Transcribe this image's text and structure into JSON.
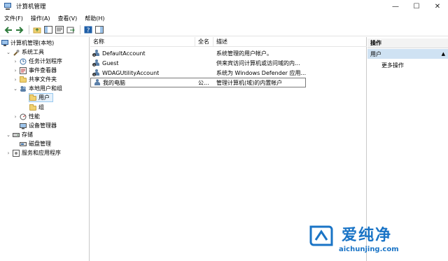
{
  "window": {
    "title": "计算机管理",
    "controls": [
      "—",
      "☐",
      "✕"
    ]
  },
  "menu": [
    {
      "label": "文件(F)"
    },
    {
      "label": "操作(A)"
    },
    {
      "label": "查看(V)"
    },
    {
      "label": "帮助(H)"
    }
  ],
  "toolbar": {
    "icons": [
      "back-arrow-icon",
      "forward-arrow-icon",
      "up-folder-icon",
      "show-tree-icon",
      "properties-icon",
      "export-icon",
      "help-icon",
      "panel-icon"
    ]
  },
  "tree": {
    "root": "计算机管理(本地)",
    "system_tools": "系统工具",
    "task_scheduler": "任务计划程序",
    "event_viewer": "事件查看器",
    "shared_folders": "共享文件夹",
    "local_users_groups": "本地用户和组",
    "users": "用户",
    "groups": "组",
    "performance": "性能",
    "device_manager": "设备管理器",
    "storage": "存储",
    "disk_management": "磁盘管理",
    "services_apps": "服务和应用程序"
  },
  "list": {
    "columns": {
      "name": "名称",
      "fullname": "全名",
      "description": "描述"
    },
    "rows": [
      {
        "name": "DefaultAccount",
        "fullname": "",
        "description": "系统管理的用户帐户。"
      },
      {
        "name": "Guest",
        "fullname": "",
        "description": "供来宾访问计算机或访问域的内..."
      },
      {
        "name": "WDAGUtilityAccount",
        "fullname": "",
        "description": "系统为 Windows Defender 应用..."
      },
      {
        "name": "我的电脑",
        "fullname": "公...",
        "description": "管理计算机(域)的内置帐户"
      }
    ]
  },
  "actions": {
    "header": "操作",
    "section": "用户",
    "more": "更多操作"
  },
  "watermark": {
    "brand": "爱纯净",
    "url": "aichunjing.com"
  },
  "colors": {
    "selection_bg": "#e5f1fb",
    "action_section_bg": "#cfe2f3",
    "watermark": "#1a74c6"
  }
}
